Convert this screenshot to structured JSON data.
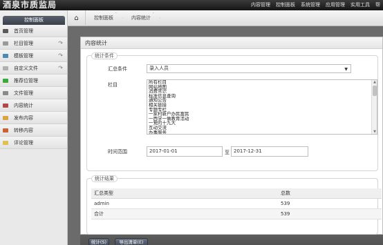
{
  "header": {
    "logo": "酒泉市质监局",
    "nav": [
      "内容管理",
      "控制面板",
      "系统管理",
      "应用管理",
      "实用工具",
      "帮"
    ]
  },
  "sidebar": {
    "title": "控制面板",
    "items": [
      {
        "label": "首页管理",
        "icon": "cloud-icon",
        "color": "#5a5a5a",
        "arrow": false
      },
      {
        "label": "栏目管理",
        "icon": "column-icon",
        "color": "#9a9a9a",
        "arrow": true
      },
      {
        "label": "模板管理",
        "icon": "template-icon",
        "color": "#4a8ab0",
        "arrow": true
      },
      {
        "label": "自定义文件",
        "icon": "file-icon",
        "color": "#b0b0b0",
        "arrow": true
      },
      {
        "label": "推荐位管理",
        "icon": "check-icon",
        "color": "#3aa83a",
        "arrow": false
      },
      {
        "label": "文件管理",
        "icon": "folder-icon",
        "color": "#8a8a8a",
        "arrow": false
      },
      {
        "label": "内容统计",
        "icon": "chart-icon",
        "color": "#b04a4a",
        "arrow": false
      },
      {
        "label": "发布内容",
        "icon": "publish-icon",
        "color": "#d9a441",
        "arrow": false
      },
      {
        "label": "转移内容",
        "icon": "transfer-icon",
        "color": "#c86432",
        "arrow": false
      },
      {
        "label": "评论管理",
        "icon": "comment-icon",
        "color": "#e0c050",
        "arrow": false
      }
    ]
  },
  "breadcrumb": [
    "控制面板",
    "内容统计"
  ],
  "panel": {
    "title": "内容统计",
    "conditions": {
      "legend": "统计条件",
      "summary_label": "汇总条件",
      "summary_value": "录入人员",
      "column_label": "栏目",
      "columns": [
        "所有栏目",
        "网站地图",
        "消费常识",
        "标准信息查询",
        "通知公告",
        "相关链接",
        "专题专栏",
        "一家村新户办民富民",
        "一西学一做教育活动",
        "一党的十九大",
        "互动交流",
        "办事服务"
      ],
      "time_label": "时间范围",
      "date_from": "2017-01-01",
      "date_sep": "至",
      "date_to": "2017-12-31"
    },
    "results": {
      "legend": "统计结果",
      "headers": [
        "汇总类型",
        "总数"
      ],
      "rows": [
        [
          "admin",
          "539"
        ],
        [
          "合计",
          "539"
        ]
      ]
    }
  },
  "footer": {
    "stat_button": "统计(S)",
    "export_button": "导出清单(E)"
  }
}
